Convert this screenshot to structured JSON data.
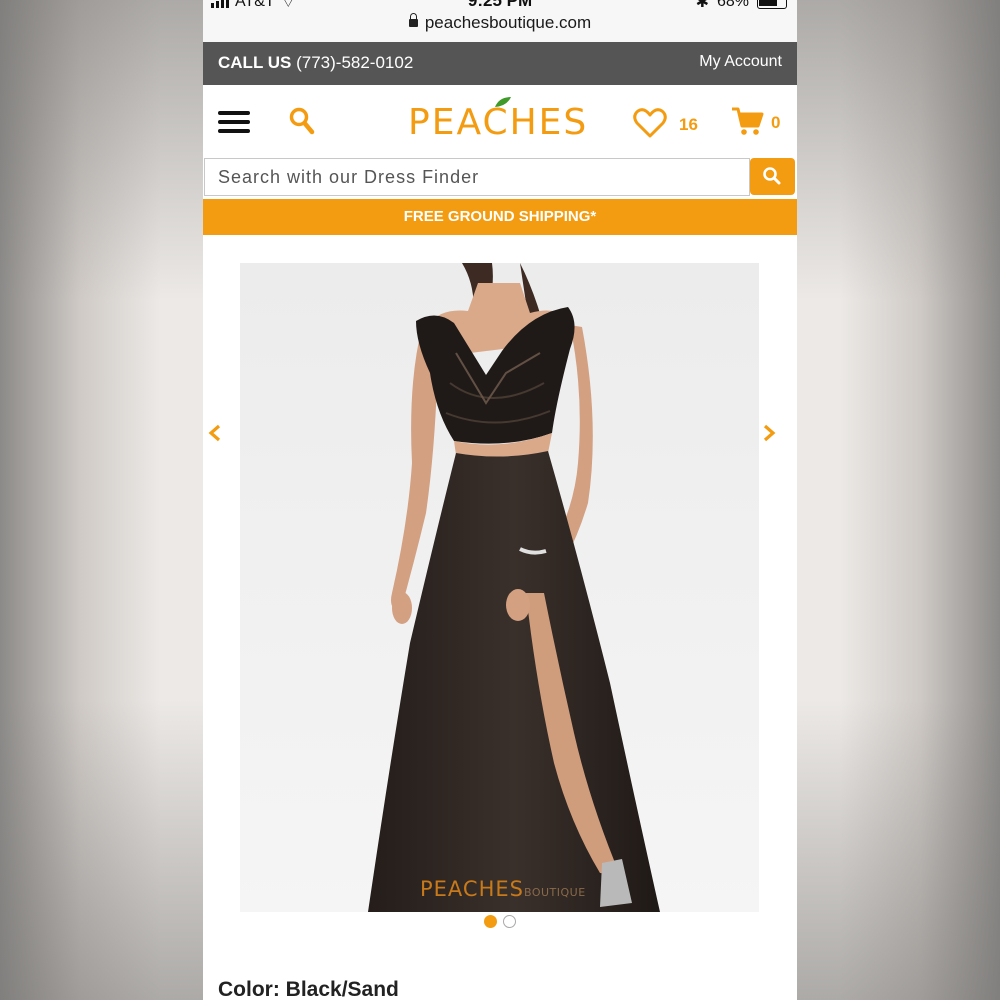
{
  "status_bar": {
    "carrier": "AT&T",
    "time": "9:25 PM",
    "battery": "68%",
    "url": "peachesboutique.com"
  },
  "topbar": {
    "call_label": "CALL US",
    "phone": "(773)-582-0102",
    "account_link": "My Account"
  },
  "header": {
    "logo": "PEACHES",
    "wishlist_count": "16",
    "cart_count": "0"
  },
  "search": {
    "placeholder": "Search with our Dress Finder"
  },
  "banner": {
    "shipping_text": "FREE GROUND SHIPPING*"
  },
  "product": {
    "watermark_brand": "PEACHES",
    "watermark_suffix": "BOUTIQUE",
    "carousel": {
      "total": 2,
      "active_index": 1
    },
    "color_label": "Color: Black/Sand"
  },
  "colors": {
    "accent": "#f39c12",
    "topbar": "#555555"
  }
}
